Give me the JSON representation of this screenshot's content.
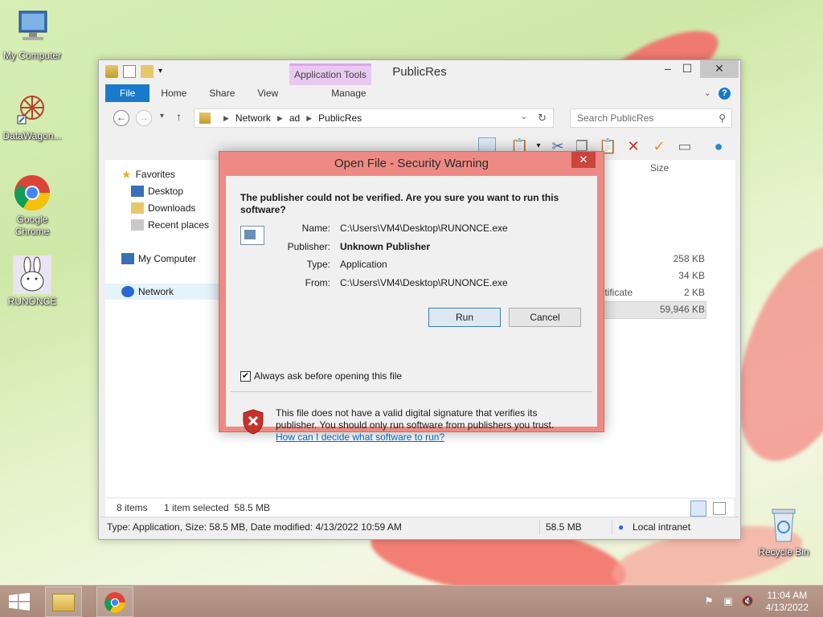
{
  "desktop": {
    "icons": [
      {
        "label": "My Computer"
      },
      {
        "label": "DataWagon..."
      },
      {
        "label": "Google Chrome"
      },
      {
        "label": "RUNONCE"
      },
      {
        "label": "Recycle Bin"
      }
    ]
  },
  "explorer": {
    "title": "PublicRes",
    "contextual_tab": "Application Tools",
    "tabs": {
      "file": "File",
      "home": "Home",
      "share": "Share",
      "view": "View",
      "manage": "Manage"
    },
    "address": {
      "parts": [
        "Network",
        "ad",
        "PublicRes"
      ]
    },
    "search_placeholder": "Search PublicRes",
    "nav": {
      "favorites": "Favorites",
      "desktop": "Desktop",
      "downloads": "Downloads",
      "recent": "Recent places",
      "my_computer": "My Computer",
      "network": "Network"
    },
    "column_size": "Size",
    "visible_cells": {
      "size1": "258 KB",
      "size2": "34 KB",
      "type3": "tificate",
      "size3": "2 KB",
      "size4": "59,946 KB"
    },
    "item_count": "8 items",
    "selection": "1 item selected  58.5 MB",
    "status": {
      "details": "Type: Application, Size: 58.5 MB, Date modified: 4/13/2022 10:59 AM",
      "size": "58.5 MB",
      "zone": "Local intranet"
    }
  },
  "dialog": {
    "title": "Open File - Security Warning",
    "question": "The publisher could not be verified.  Are you sure you want to run this software?",
    "fields": {
      "name_label": "Name:",
      "name": "C:\\Users\\VM4\\Desktop\\RUNONCE.exe",
      "publisher_label": "Publisher:",
      "publisher": "Unknown Publisher",
      "type_label": "Type:",
      "type": "Application",
      "from_label": "From:",
      "from": "C:\\Users\\VM4\\Desktop\\RUNONCE.exe"
    },
    "run_label": "Run",
    "cancel_label": "Cancel",
    "checkbox_label": "Always ask before opening this file",
    "checkbox_checked": true,
    "footer_text": "This file does not have a valid digital signature that verifies its publisher.  You should only run software from publishers you trust.",
    "footer_link": "How can I decide what software to run?"
  },
  "taskbar": {
    "time": "11:04 AM",
    "date": "4/13/2022"
  },
  "colors": {
    "dialog_border": "#ed8a83",
    "accent": "#1979ca",
    "taskbar": "#b09184"
  }
}
